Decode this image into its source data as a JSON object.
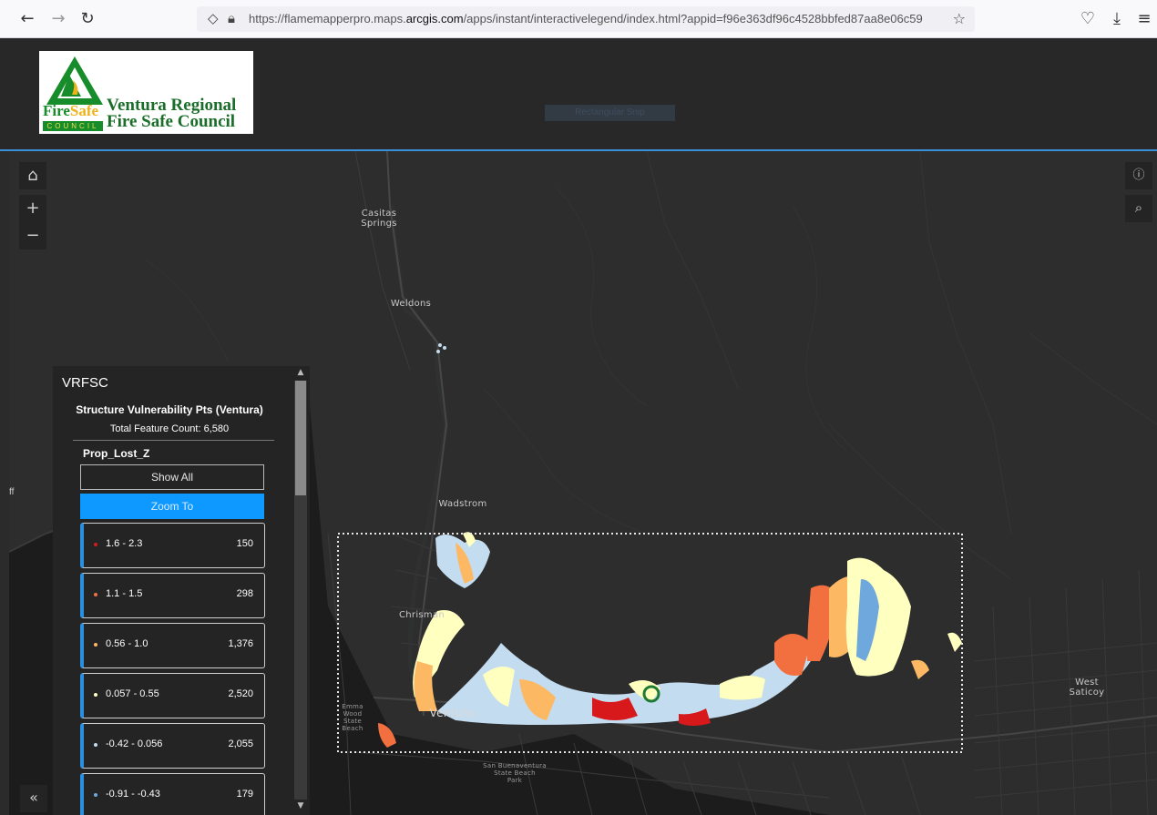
{
  "browser": {
    "back_icon": "arrow-left-icon",
    "forward_icon": "arrow-right-icon",
    "reload_icon": "reload-icon",
    "url_prefix": "https://flamemapperpro.maps.",
    "url_domain": "arcgis.com",
    "url_path": "/apps/instant/interactivelegend/index.html?appid=f96e363df96c4528bbfed87aa8e06c59"
  },
  "header": {
    "logo": {
      "fire": "Fire",
      "safe": "Safe",
      "council": "COUNCIL",
      "title_line1": "Ventura Regional",
      "title_line2": "Fire Safe Council"
    },
    "snip_button": "Rectangular Snip"
  },
  "map": {
    "places": {
      "casitas": "Casitas\nSprings",
      "weldons": "Weldons",
      "wadstrom": "Wadstrom",
      "chrisman": "Chrisman",
      "ventura": "Ventura",
      "west_saticoy": "West\nSaticoy",
      "emma_wood": "Emma\nWood\nState\nBeach",
      "san_buenaventura": "San Buenaventura\nState Beach\nPark",
      "ff": "ff"
    }
  },
  "legend": {
    "title": "VRFSC",
    "layer_title": "Structure Vulnerability Pts (Ventura)",
    "feature_count": "Total Feature Count: 6,580",
    "field": "Prop_Lost_Z",
    "show_all": "Show All",
    "zoom_to": "Zoom To",
    "classes": [
      {
        "range": "1.6 - 2.3",
        "count": "150",
        "color": "#d7191c"
      },
      {
        "range": "1.1 - 1.5",
        "count": "298",
        "color": "#f2703f"
      },
      {
        "range": "0.56 - 1.0",
        "count": "1,376",
        "color": "#fdb863"
      },
      {
        "range": "0.057 - 0.55",
        "count": "2,520",
        "color": "#ffffbf"
      },
      {
        "range": "-0.42 - 0.056",
        "count": "2,055",
        "color": "#c4dcef"
      },
      {
        "range": "-0.91 - -0.43",
        "count": "179",
        "color": "#6fa8dc"
      }
    ]
  }
}
